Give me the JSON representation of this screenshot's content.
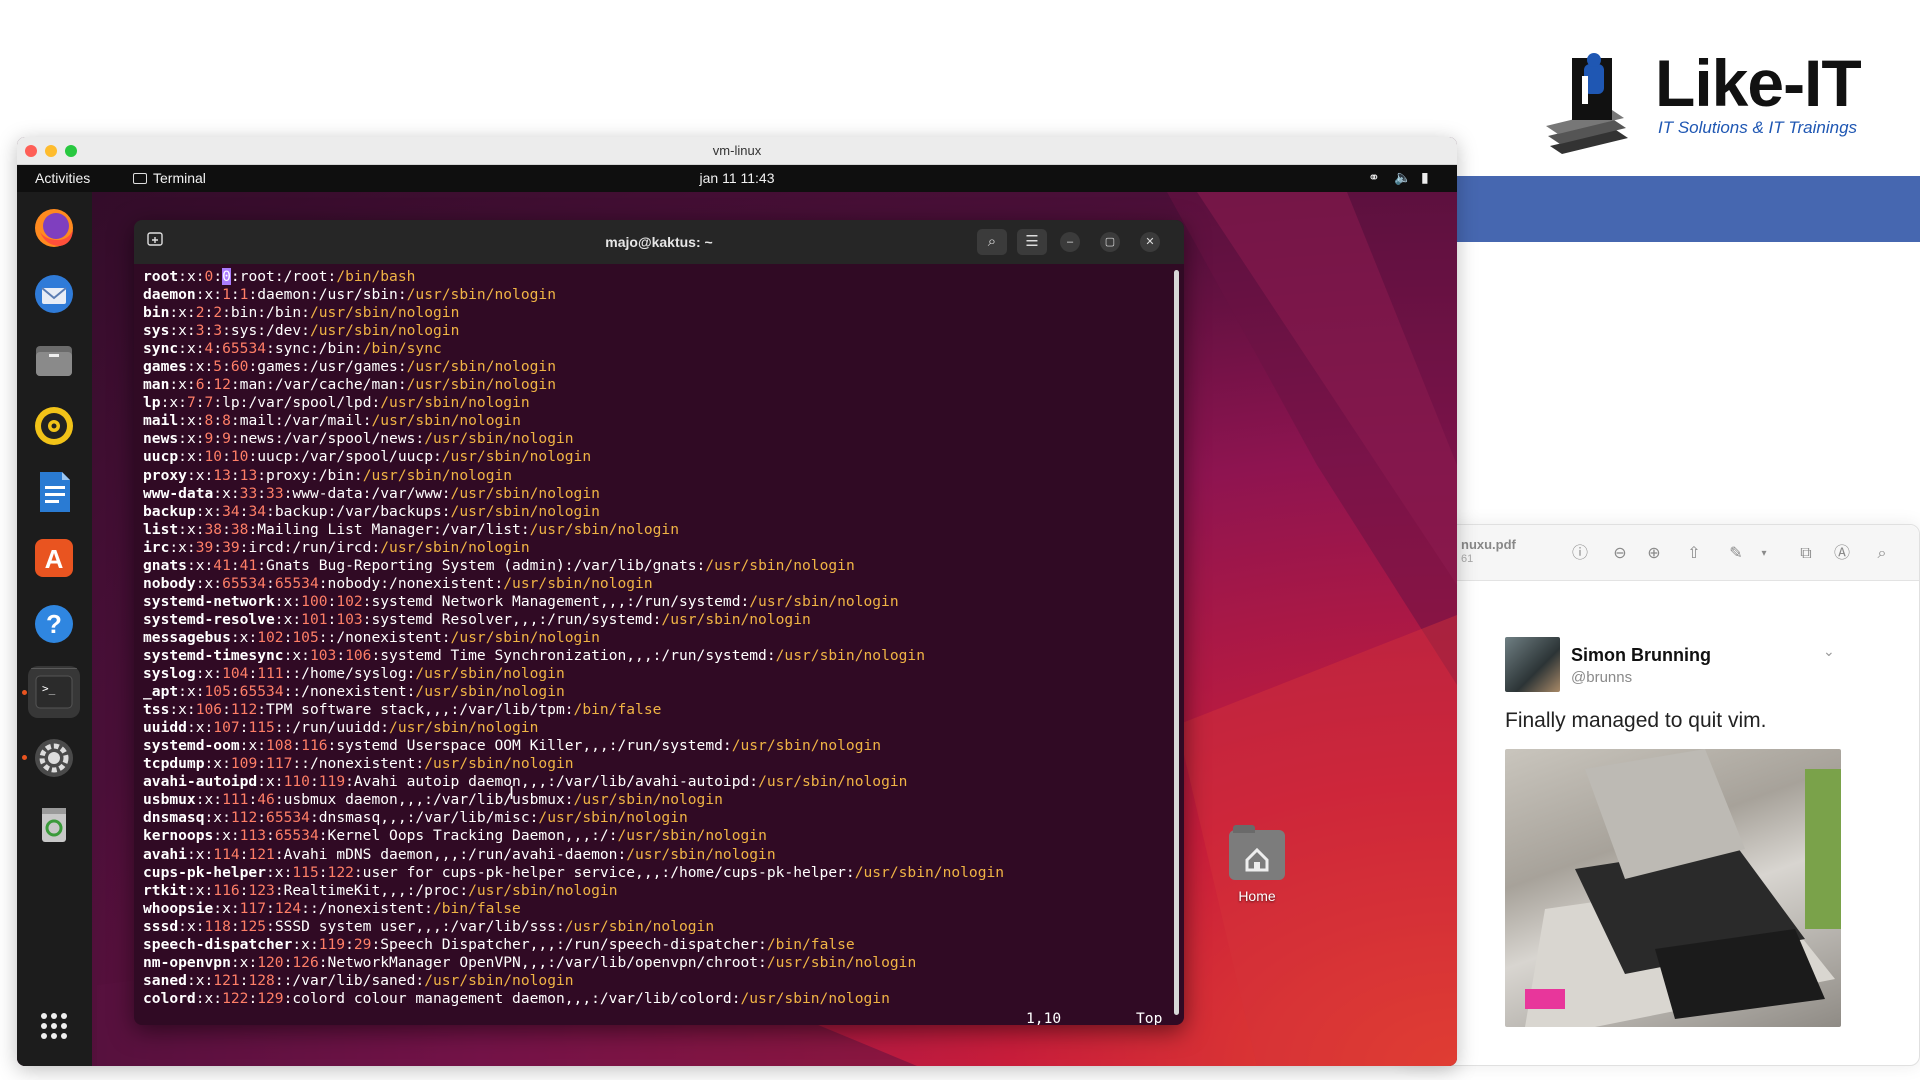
{
  "logo": {
    "brand_name": "Like-IT",
    "tagline": "IT Solutions & IT Trainings"
  },
  "pdf_viewer": {
    "filename": "nuxu.pdf",
    "pages": "61",
    "tool_icons": [
      "info-icon",
      "zoom-out-icon",
      "zoom-in-icon",
      "share-icon",
      "pen-icon",
      "chevron-down-icon",
      "rotate-icon",
      "markup-icon",
      "search-icon"
    ],
    "tweet": {
      "name": "Simon Brunning",
      "handle": "@brunns",
      "text": "Finally managed to quit vim."
    }
  },
  "vm_window": {
    "title": "vm-linux"
  },
  "topbar": {
    "activities": "Activities",
    "app_name": "Terminal",
    "clock": "jan 11  11:43",
    "colors": {
      "background": "#0f0f0f",
      "accent": "#e95420"
    }
  },
  "dock": {
    "items": [
      "firefox-icon",
      "thunderbird-icon",
      "files-icon",
      "rhythmbox-icon",
      "libreoffice-writer-icon",
      "app-center-icon",
      "help-icon",
      "terminal-icon",
      "settings-icon",
      "trash-icon"
    ],
    "show_apps": "app-grid-icon"
  },
  "desktop": {
    "home_label": "Home"
  },
  "terminal": {
    "title": "majo@kaktus: ~",
    "status_position": "1,10",
    "status_scroll": "Top",
    "colors": {
      "background": "#300a24",
      "number": "#ff7f67",
      "shell": "#f0b445"
    },
    "lines": [
      [
        "root",
        ":x:",
        "0",
        ":",
        "0",
        ":root:/root:",
        "/bin/bash"
      ],
      [
        "daemon",
        ":x:",
        "1",
        ":",
        "1",
        ":daemon:/usr/sbin:",
        "/usr/sbin/nologin"
      ],
      [
        "bin",
        ":x:",
        "2",
        ":",
        "2",
        ":bin:/bin:",
        "/usr/sbin/nologin"
      ],
      [
        "sys",
        ":x:",
        "3",
        ":",
        "3",
        ":sys:/dev:",
        "/usr/sbin/nologin"
      ],
      [
        "sync",
        ":x:",
        "4",
        ":",
        "65534",
        ":sync:/bin:",
        "/bin/sync"
      ],
      [
        "games",
        ":x:",
        "5",
        ":",
        "60",
        ":games:/usr/games:",
        "/usr/sbin/nologin"
      ],
      [
        "man",
        ":x:",
        "6",
        ":",
        "12",
        ":man:/var/cache/man:",
        "/usr/sbin/nologin"
      ],
      [
        "lp",
        ":x:",
        "7",
        ":",
        "7",
        ":lp:/var/spool/lpd:",
        "/usr/sbin/nologin"
      ],
      [
        "mail",
        ":x:",
        "8",
        ":",
        "8",
        ":mail:/var/mail:",
        "/usr/sbin/nologin"
      ],
      [
        "news",
        ":x:",
        "9",
        ":",
        "9",
        ":news:/var/spool/news:",
        "/usr/sbin/nologin"
      ],
      [
        "uucp",
        ":x:",
        "10",
        ":",
        "10",
        ":uucp:/var/spool/uucp:",
        "/usr/sbin/nologin"
      ],
      [
        "proxy",
        ":x:",
        "13",
        ":",
        "13",
        ":proxy:/bin:",
        "/usr/sbin/nologin"
      ],
      [
        "www-data",
        ":x:",
        "33",
        ":",
        "33",
        ":www-data:/var/www:",
        "/usr/sbin/nologin"
      ],
      [
        "backup",
        ":x:",
        "34",
        ":",
        "34",
        ":backup:/var/backups:",
        "/usr/sbin/nologin"
      ],
      [
        "list",
        ":x:",
        "38",
        ":",
        "38",
        ":Mailing List Manager:/var/list:",
        "/usr/sbin/nologin"
      ],
      [
        "irc",
        ":x:",
        "39",
        ":",
        "39",
        ":ircd:/run/ircd:",
        "/usr/sbin/nologin"
      ],
      [
        "gnats",
        ":x:",
        "41",
        ":",
        "41",
        ":Gnats Bug-Reporting System (admin):/var/lib/gnats:",
        "/usr/sbin/nologin"
      ],
      [
        "nobody",
        ":x:",
        "65534",
        ":",
        "65534",
        ":nobody:/nonexistent:",
        "/usr/sbin/nologin"
      ],
      [
        "systemd-network",
        ":x:",
        "100",
        ":",
        "102",
        ":systemd Network Management,,,:/run/systemd:",
        "/usr/sbin/nologin"
      ],
      [
        "systemd-resolve",
        ":x:",
        "101",
        ":",
        "103",
        ":systemd Resolver,,,:/run/systemd:",
        "/usr/sbin/nologin"
      ],
      [
        "messagebus",
        ":x:",
        "102",
        ":",
        "105",
        "::/nonexistent:",
        "/usr/sbin/nologin"
      ],
      [
        "systemd-timesync",
        ":x:",
        "103",
        ":",
        "106",
        ":systemd Time Synchronization,,,:/run/systemd:",
        "/usr/sbin/nologin"
      ],
      [
        "syslog",
        ":x:",
        "104",
        ":",
        "111",
        "::/home/syslog:",
        "/usr/sbin/nologin"
      ],
      [
        "_apt",
        ":x:",
        "105",
        ":",
        "65534",
        "::/nonexistent:",
        "/usr/sbin/nologin"
      ],
      [
        "tss",
        ":x:",
        "106",
        ":",
        "112",
        ":TPM software stack,,,:/var/lib/tpm:",
        "/bin/false"
      ],
      [
        "uuidd",
        ":x:",
        "107",
        ":",
        "115",
        "::/run/uuidd:",
        "/usr/sbin/nologin"
      ],
      [
        "systemd-oom",
        ":x:",
        "108",
        ":",
        "116",
        ":systemd Userspace OOM Killer,,,:/run/systemd:",
        "/usr/sbin/nologin"
      ],
      [
        "tcpdump",
        ":x:",
        "109",
        ":",
        "117",
        "::/nonexistent:",
        "/usr/sbin/nologin"
      ],
      [
        "avahi-autoipd",
        ":x:",
        "110",
        ":",
        "119",
        ":Avahi autoip daemon,,,:/var/lib/avahi-autoipd:",
        "/usr/sbin/nologin"
      ],
      [
        "usbmux",
        ":x:",
        "111",
        ":",
        "46",
        ":usbmux daemon,,,:/var/lib/usbmux:",
        "/usr/sbin/nologin"
      ],
      [
        "dnsmasq",
        ":x:",
        "112",
        ":",
        "65534",
        ":dnsmasq,,,:/var/lib/misc:",
        "/usr/sbin/nologin"
      ],
      [
        "kernoops",
        ":x:",
        "113",
        ":",
        "65534",
        ":Kernel Oops Tracking Daemon,,,:/:",
        "/usr/sbin/nologin"
      ],
      [
        "avahi",
        ":x:",
        "114",
        ":",
        "121",
        ":Avahi mDNS daemon,,,:/run/avahi-daemon:",
        "/usr/sbin/nologin"
      ],
      [
        "cups-pk-helper",
        ":x:",
        "115",
        ":",
        "122",
        ":user for cups-pk-helper service,,,:/home/cups-pk-helper:",
        "/usr/sbin/nologin"
      ],
      [
        "rtkit",
        ":x:",
        "116",
        ":",
        "123",
        ":RealtimeKit,,,:/proc:",
        "/usr/sbin/nologin"
      ],
      [
        "whoopsie",
        ":x:",
        "117",
        ":",
        "124",
        "::/nonexistent:",
        "/bin/false"
      ],
      [
        "sssd",
        ":x:",
        "118",
        ":",
        "125",
        ":SSSD system user,,,:/var/lib/sss:",
        "/usr/sbin/nologin"
      ],
      [
        "speech-dispatcher",
        ":x:",
        "119",
        ":",
        "29",
        ":Speech Dispatcher,,,:/run/speech-dispatcher:",
        "/bin/false"
      ],
      [
        "nm-openvpn",
        ":x:",
        "120",
        ":",
        "126",
        ":NetworkManager OpenVPN,,,:/var/lib/openvpn/chroot:",
        "/usr/sbin/nologin"
      ],
      [
        "saned",
        ":x:",
        "121",
        ":",
        "128",
        "::/var/lib/saned:",
        "/usr/sbin/nologin"
      ],
      [
        "colord",
        ":x:",
        "122",
        ":",
        "129",
        ":colord colour management daemon,,,:/var/lib/colord:",
        "/usr/sbin/nologin"
      ]
    ]
  }
}
